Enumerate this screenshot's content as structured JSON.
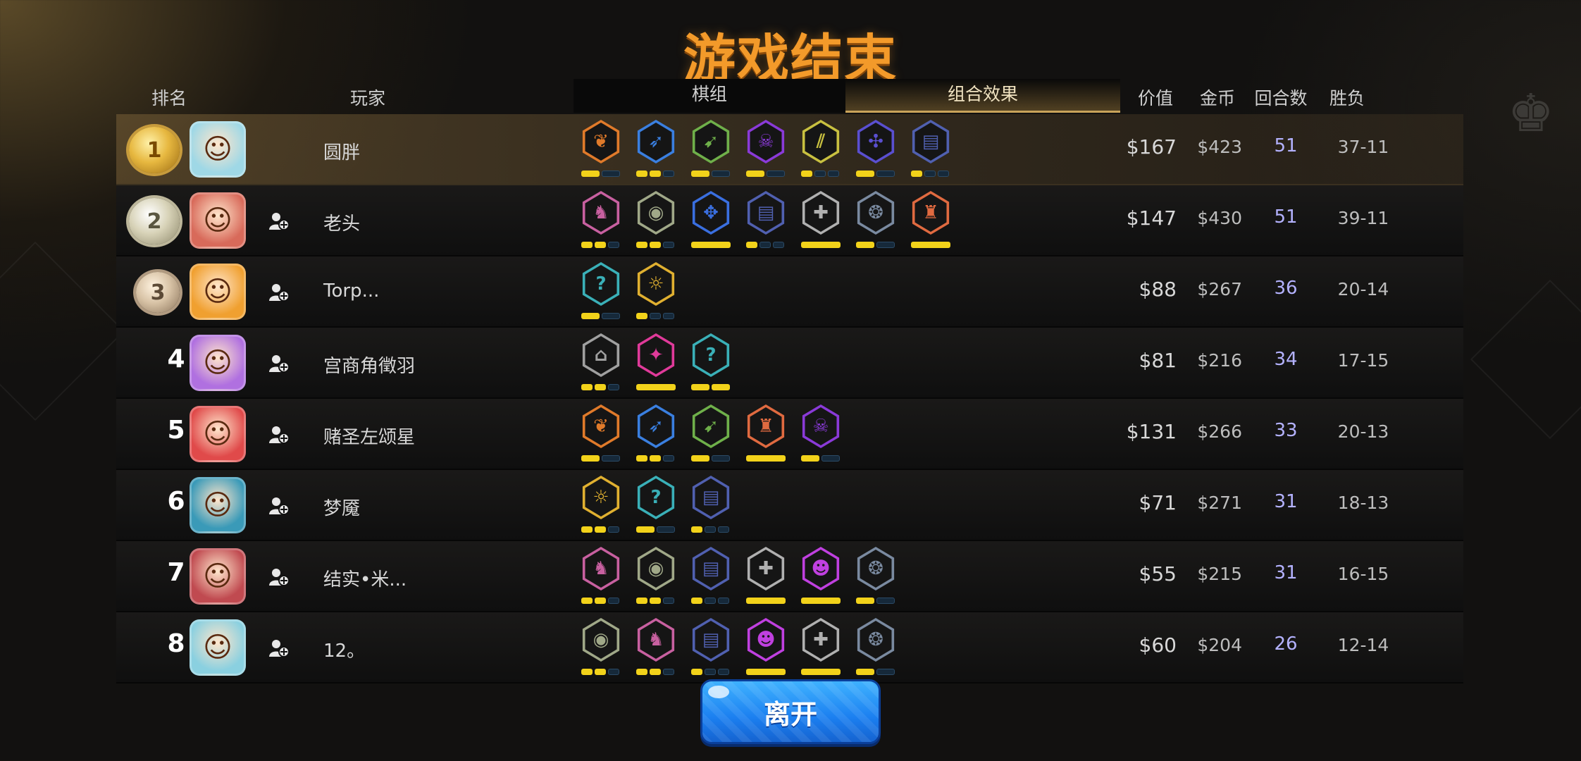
{
  "title": "游戏结束",
  "header": {
    "rank": "排名",
    "player": "玩家",
    "tab_pieces": "棋组",
    "tab_synergy": "组合效果",
    "value": "价值",
    "gold": "金币",
    "rounds": "回合数",
    "winloss": "胜负"
  },
  "leave_button": "离开",
  "colors": {
    "title": "#f39a2a",
    "rounds_text": "#b4b2ff",
    "pip_on": "#f2d21a",
    "button": "#1b7ff0"
  },
  "players": [
    {
      "rank": "1",
      "medal": "gold",
      "avatar_icon": "yeti-hero",
      "avatar_color": "#9fd8e6",
      "name": "圆胖",
      "add_friend": false,
      "value": "$167",
      "gold": "$423",
      "rounds": "51",
      "wl": "37-11",
      "synergies": [
        {
          "icon": "leaf",
          "glyph": "❦",
          "color": "#e07a2a",
          "pips": [
            1,
            0
          ]
        },
        {
          "icon": "feather",
          "glyph": "➶",
          "color": "#3a7fe0",
          "pips": [
            1,
            1,
            0
          ]
        },
        {
          "icon": "bow",
          "glyph": "➹",
          "color": "#6fb04a",
          "pips": [
            1,
            0
          ]
        },
        {
          "icon": "demon-mask",
          "glyph": "☠",
          "color": "#8a3ad8",
          "pips": [
            1,
            0
          ]
        },
        {
          "icon": "claw",
          "glyph": "⫽",
          "color": "#c8c040",
          "pips": [
            1,
            0,
            0
          ]
        },
        {
          "icon": "fish-bone",
          "glyph": "✣",
          "color": "#5a4fd0",
          "pips": [
            1,
            0
          ]
        },
        {
          "icon": "spellbook",
          "glyph": "▤",
          "color": "#5060b0",
          "pips": [
            1,
            0,
            0
          ]
        }
      ]
    },
    {
      "rank": "2",
      "medal": "silver",
      "avatar_icon": "ogre-hero",
      "avatar_color": "#d86a5a",
      "name": "老头",
      "add_friend": true,
      "value": "$147",
      "gold": "$430",
      "rounds": "51",
      "wl": "39-11",
      "synergies": [
        {
          "icon": "knight",
          "glyph": "♞",
          "color": "#c860a0",
          "pips": [
            1,
            1,
            0
          ]
        },
        {
          "icon": "penguin",
          "glyph": "◉",
          "color": "#a0a888",
          "pips": [
            1,
            1,
            0
          ]
        },
        {
          "icon": "dragon-wing",
          "glyph": "✥",
          "color": "#3a6fe0",
          "pips": [
            1
          ]
        },
        {
          "icon": "spellbook",
          "glyph": "▤",
          "color": "#5060b0",
          "pips": [
            1,
            0,
            0
          ]
        },
        {
          "icon": "cross",
          "glyph": "✚",
          "color": "#b0b0b0",
          "pips": [
            1
          ]
        },
        {
          "icon": "ghost-wave",
          "glyph": "❂",
          "color": "#7a8aa0",
          "pips": [
            1,
            0
          ]
        },
        {
          "icon": "viking-helmet",
          "glyph": "♜",
          "color": "#e06a40",
          "pips": [
            1
          ]
        }
      ]
    },
    {
      "rank": "3",
      "medal": "bronze",
      "avatar_icon": "princess-hero",
      "avatar_color": "#f0a030",
      "name": "Torp...",
      "add_friend": true,
      "value": "$88",
      "gold": "$267",
      "rounds": "36",
      "wl": "20-14",
      "synergies": [
        {
          "icon": "hook-rune",
          "glyph": "?",
          "color": "#3ab0b8",
          "pips": [
            1,
            0
          ]
        },
        {
          "icon": "sun-mask",
          "glyph": "☼",
          "color": "#e0b030",
          "pips": [
            1,
            0,
            0
          ]
        }
      ]
    },
    {
      "rank": "4",
      "medal": "",
      "avatar_icon": "fairy-hero",
      "avatar_color": "#b070e0",
      "name": "宫商角徵羽",
      "add_friend": true,
      "value": "$81",
      "gold": "$216",
      "rounds": "34",
      "wl": "17-15",
      "synergies": [
        {
          "icon": "podium",
          "glyph": "⌂",
          "color": "#a0a0a0",
          "pips": [
            1,
            1,
            0
          ]
        },
        {
          "icon": "bat-wing",
          "glyph": "✦",
          "color": "#e03a9a",
          "pips": [
            1
          ]
        },
        {
          "icon": "hook-rune",
          "glyph": "?",
          "color": "#3ab0b8",
          "pips": [
            1,
            1
          ]
        }
      ]
    },
    {
      "rank": "5",
      "medal": "",
      "avatar_icon": "pirate-hero",
      "avatar_color": "#e04a4a",
      "name": "赌圣左颂星",
      "add_friend": true,
      "value": "$131",
      "gold": "$266",
      "rounds": "33",
      "wl": "20-13",
      "synergies": [
        {
          "icon": "leaf",
          "glyph": "❦",
          "color": "#e07a2a",
          "pips": [
            1,
            0
          ]
        },
        {
          "icon": "feather",
          "glyph": "➶",
          "color": "#3a7fe0",
          "pips": [
            1,
            1,
            0
          ]
        },
        {
          "icon": "bow",
          "glyph": "➹",
          "color": "#6fb04a",
          "pips": [
            1,
            0
          ]
        },
        {
          "icon": "viking-helmet",
          "glyph": "♜",
          "color": "#e06a40",
          "pips": [
            1
          ]
        },
        {
          "icon": "demon-mask",
          "glyph": "☠",
          "color": "#8a3ad8",
          "pips": [
            1,
            0
          ]
        }
      ]
    },
    {
      "rank": "6",
      "medal": "",
      "avatar_icon": "shark-hero",
      "avatar_color": "#3a9ab8",
      "name": "梦魇",
      "add_friend": true,
      "value": "$71",
      "gold": "$271",
      "rounds": "31",
      "wl": "18-13",
      "synergies": [
        {
          "icon": "sun-mask",
          "glyph": "☼",
          "color": "#e0b030",
          "pips": [
            1,
            1,
            0
          ]
        },
        {
          "icon": "hook-rune",
          "glyph": "?",
          "color": "#3ab0b8",
          "pips": [
            1,
            0
          ]
        },
        {
          "icon": "spellbook",
          "glyph": "▤",
          "color": "#5060b0",
          "pips": [
            1,
            0,
            0
          ]
        }
      ]
    },
    {
      "rank": "7",
      "medal": "",
      "avatar_icon": "witch-hero",
      "avatar_color": "#c04a50",
      "name": "结实•米...",
      "add_friend": true,
      "value": "$55",
      "gold": "$215",
      "rounds": "31",
      "wl": "16-15",
      "synergies": [
        {
          "icon": "knight",
          "glyph": "♞",
          "color": "#c860a0",
          "pips": [
            1,
            1,
            0
          ]
        },
        {
          "icon": "penguin",
          "glyph": "◉",
          "color": "#a0a888",
          "pips": [
            1,
            1,
            0
          ]
        },
        {
          "icon": "spellbook",
          "glyph": "▤",
          "color": "#5060b0",
          "pips": [
            1,
            0,
            0
          ]
        },
        {
          "icon": "cross",
          "glyph": "✚",
          "color": "#b0b0b0",
          "pips": [
            1
          ]
        },
        {
          "icon": "skull-spirit",
          "glyph": "☻",
          "color": "#c040e0",
          "pips": [
            1
          ]
        },
        {
          "icon": "ghost-wave",
          "glyph": "❂",
          "color": "#7a8aa0",
          "pips": [
            1,
            0
          ]
        }
      ]
    },
    {
      "rank": "8",
      "medal": "",
      "avatar_icon": "snow-hero",
      "avatar_color": "#8ad0e0",
      "name": "12。",
      "add_friend": true,
      "value": "$60",
      "gold": "$204",
      "rounds": "26",
      "wl": "12-14",
      "synergies": [
        {
          "icon": "penguin",
          "glyph": "◉",
          "color": "#a0a888",
          "pips": [
            1,
            1,
            0
          ]
        },
        {
          "icon": "knight",
          "glyph": "♞",
          "color": "#c860a0",
          "pips": [
            1,
            1,
            0
          ]
        },
        {
          "icon": "spellbook",
          "glyph": "▤",
          "color": "#5060b0",
          "pips": [
            1,
            0,
            0
          ]
        },
        {
          "icon": "skull-spirit",
          "glyph": "☻",
          "color": "#c040e0",
          "pips": [
            1
          ]
        },
        {
          "icon": "cross",
          "glyph": "✚",
          "color": "#b0b0b0",
          "pips": [
            1
          ]
        },
        {
          "icon": "ghost-wave",
          "glyph": "❂",
          "color": "#7a8aa0",
          "pips": [
            1,
            0
          ]
        }
      ]
    }
  ]
}
